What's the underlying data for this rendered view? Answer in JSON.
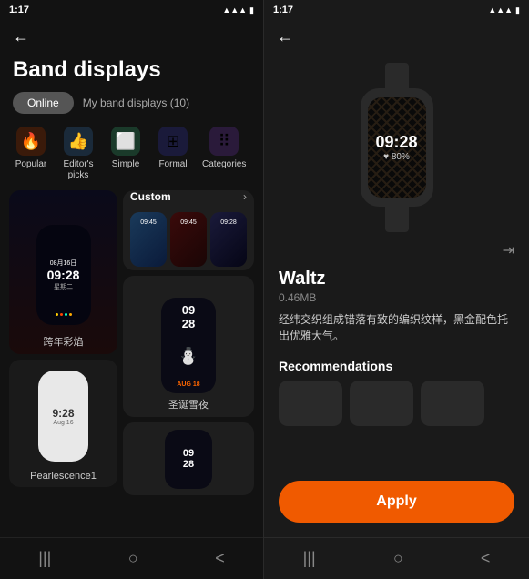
{
  "left": {
    "status": {
      "time": "1:17",
      "icons": "●●"
    },
    "back_label": "←",
    "page_title": "Band displays",
    "tabs": {
      "online": "Online",
      "myband": "My band displays (10)"
    },
    "categories": [
      {
        "id": "popular",
        "label": "Popular",
        "icon": "🔥"
      },
      {
        "id": "editors",
        "label": "Editor's picks",
        "icon": "👍"
      },
      {
        "id": "simple",
        "label": "Simple",
        "icon": "⬜"
      },
      {
        "id": "formal",
        "label": "Formal",
        "icon": "⊞"
      },
      {
        "id": "categories",
        "label": "Categories",
        "icon": "⠿"
      }
    ],
    "cards": [
      {
        "name": "跨年彩焰",
        "time": "09:28",
        "date": "08月16日",
        "day": "星期二"
      },
      {
        "name": "Pearlescence1"
      },
      {
        "name": "Custom"
      },
      {
        "name": "圣诞雪夜"
      },
      {
        "name": "partial",
        "time": "09\n28"
      }
    ]
  },
  "right": {
    "status": {
      "time": "1:17"
    },
    "back_label": "←",
    "watch": {
      "time": "09:28",
      "sub": "♥ 80%"
    },
    "share_icon": "⇥",
    "watch_name": "Waltz",
    "watch_size": "0.46MB",
    "description": "经纬交织组成错落有致的编织纹样，黑金配色托出优雅大气。",
    "recommendations_label": "Recommendations",
    "apply_label": "Apply"
  },
  "nav": {
    "icons": [
      "|||",
      "○",
      "<"
    ]
  }
}
